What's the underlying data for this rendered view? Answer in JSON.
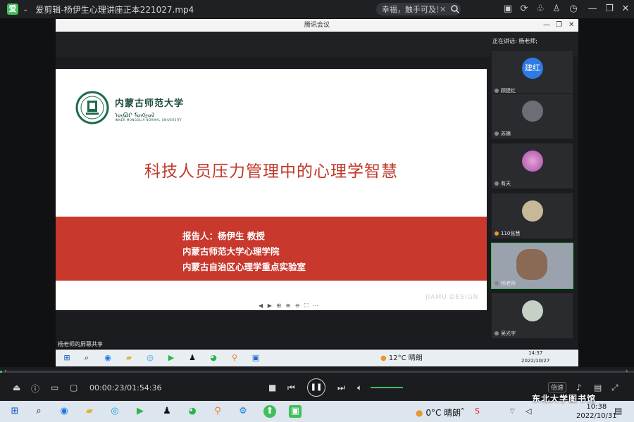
{
  "player": {
    "app_logo": "爱",
    "title": "爱剪辑-杨伊生心理讲座正本221027.mp4",
    "search_text": "幸福，触手可及！",
    "timecode": "00:00:23/01:54:36",
    "progress": 0.0034,
    "speed_label": "倍速"
  },
  "meeting": {
    "window_title": "腾讯会议",
    "speaking_label": "正在讲话: 杨老师;",
    "share_label": "杨老师的屏幕共享",
    "slide_controls": "◀ ▶ ⊞ ⊕ ⊖ ⛶ ⋯",
    "participants": [
      {
        "avatar_text": "建红",
        "name": "顾建红"
      },
      {
        "avatar_text": "",
        "name": "苏姨"
      },
      {
        "avatar_text": "",
        "name": "有天"
      },
      {
        "avatar_text": "",
        "name": "110张慧"
      },
      {
        "avatar_text": "",
        "name": "杨老师"
      },
      {
        "avatar_text": "",
        "name": "吴光宇"
      }
    ]
  },
  "slide": {
    "uni_name": "内蒙古师范大学",
    "uni_mongol": "ᠥᠪᠦᠷ ᠮᠣᠩᠭᠣᠯ",
    "uni_en": "INNER MONGOLIA NORMAL UNIVERSITY",
    "title": "科技人员压力管理中的心理学智慧",
    "reporter": "报告人：杨伊生 教授",
    "college": "内蒙古师范大学心理学院",
    "lab": "内蒙古自治区心理学重点实验室",
    "watermark": "JIAMU DESIGN"
  },
  "inner_taskbar": {
    "weather": "12°C 晴朗",
    "time": "14:37",
    "date": "2022/10/27"
  },
  "host_taskbar": {
    "weather": "0°C 晴朗",
    "time": "10:38",
    "date": "2022/10/31"
  },
  "corner_watermark": "东北大学图书馆",
  "colors": {
    "accent_green": "#3fbf5a",
    "slide_red": "#c8382d",
    "title_red": "#c0392b",
    "avatar_blue": "#2f7ae5"
  }
}
